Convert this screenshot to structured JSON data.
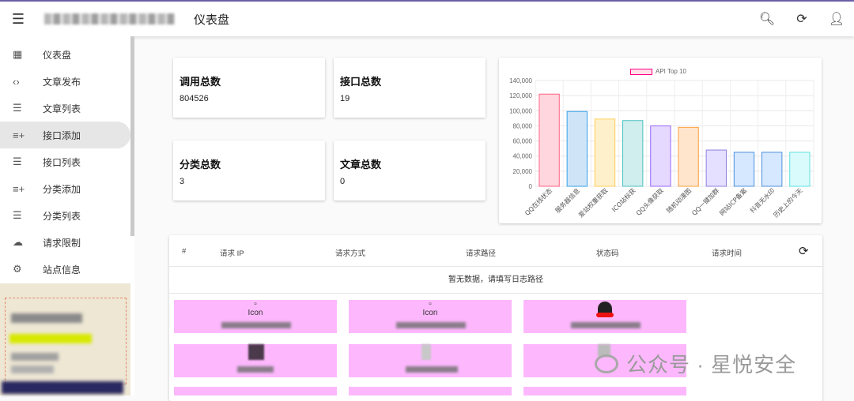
{
  "header": {
    "title": "仪表盘",
    "icons": [
      "menu-icon",
      "search-icon",
      "refresh-icon",
      "account-icon"
    ]
  },
  "sidebar": {
    "items": [
      {
        "label": "仪表盘",
        "icon": "dashboard-icon",
        "glyph": "▦"
      },
      {
        "label": "文章发布",
        "icon": "code-icon",
        "glyph": "‹›"
      },
      {
        "label": "文章列表",
        "icon": "list-icon",
        "glyph": "☰"
      },
      {
        "label": "接口添加",
        "icon": "playlist-add-icon",
        "glyph": "≡+",
        "active": true
      },
      {
        "label": "接口列表",
        "icon": "list-icon",
        "glyph": "☰"
      },
      {
        "label": "分类添加",
        "icon": "playlist-add-icon",
        "glyph": "≡+"
      },
      {
        "label": "分类列表",
        "icon": "list-icon",
        "glyph": "☰"
      },
      {
        "label": "请求限制",
        "icon": "cloud-icon",
        "glyph": "☁"
      },
      {
        "label": "站点信息",
        "icon": "gear-icon",
        "glyph": "⚙"
      }
    ]
  },
  "stats": [
    {
      "label": "调用总数",
      "value": "804526"
    },
    {
      "label": "接口总数",
      "value": "19"
    },
    {
      "label": "分类总数",
      "value": "3"
    },
    {
      "label": "文章总数",
      "value": "0"
    }
  ],
  "chart_data": {
    "type": "bar",
    "title": "",
    "legend": "API Top 10",
    "legend_position": "top-center",
    "grid": true,
    "categories": [
      "QQ在线状态",
      "服务器信息",
      "爱站权重获取",
      "ICO站标获",
      "QQ头像获取",
      "随机动漫图",
      "QQ一键加群",
      "网站ICP备案",
      "抖音无水印",
      "历史上的今天"
    ],
    "values": [
      122000,
      99000,
      89000,
      87000,
      80000,
      78000,
      48000,
      45000,
      45000,
      45000
    ],
    "ylim": [
      0,
      140000
    ],
    "yticks": [
      "0",
      "20,000",
      "40,000",
      "60,000",
      "80,000",
      "100,000",
      "120,000",
      "140,000"
    ],
    "colors": [
      {
        "fill": "#ffd6dd",
        "stroke": "#ff6384"
      },
      {
        "fill": "#cfe5f7",
        "stroke": "#36a2eb"
      },
      {
        "fill": "#fff0cc",
        "stroke": "#ffce56"
      },
      {
        "fill": "#d0eeee",
        "stroke": "#4bc0c0"
      },
      {
        "fill": "#e5d9ff",
        "stroke": "#9966ff"
      },
      {
        "fill": "#ffe5cc",
        "stroke": "#ff9f40"
      },
      {
        "fill": "#e5e0ff",
        "stroke": "#8c80e0"
      },
      {
        "fill": "#d6e8ff",
        "stroke": "#4d90e0"
      },
      {
        "fill": "#d6e8ff",
        "stroke": "#4d90e0"
      },
      {
        "fill": "#d9fbfb",
        "stroke": "#5fe0e0"
      }
    ]
  },
  "table": {
    "columns": [
      "#",
      "请求 IP",
      "请求方式",
      "请求路径",
      "状态码",
      "请求时间"
    ],
    "empty_text": "暂无数据，请填写日志路径"
  },
  "tiles": [
    {
      "img_alt": "Icon"
    },
    {
      "img_alt": "Icon"
    }
  ],
  "watermark": "公众号 · 星悦安全"
}
